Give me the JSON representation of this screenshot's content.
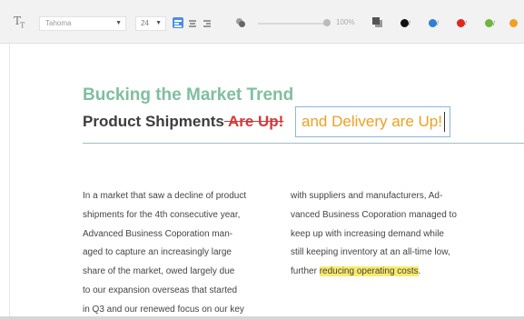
{
  "toolbar": {
    "text_tool_icon": "text-size-icon",
    "font": {
      "value": "Tahoma"
    },
    "size": {
      "value": "24"
    },
    "alignment": [
      "left",
      "center",
      "right"
    ],
    "active_alignment": "left",
    "zoom_label": "100%",
    "zoom_fraction": 0.95,
    "swatches": [
      {
        "name": "black",
        "color": "#111111"
      },
      {
        "name": "blue",
        "color": "#2f7fd9"
      },
      {
        "name": "red",
        "color": "#e0261d"
      },
      {
        "name": "green",
        "color": "#6ab83a"
      },
      {
        "name": "orange",
        "color": "#f0a020"
      }
    ]
  },
  "document": {
    "title": "Bucking the Market Trend",
    "subtitle": "Product Shipments",
    "struck": " Are Up!",
    "inserted": "and Delivery are Up!",
    "colors": {
      "title": "#7fbf9f",
      "strike": "#d23b3b",
      "inserted": "#f0a020",
      "highlight": "#f7ec6a"
    },
    "column1": [
      "In a market that saw a decline of product",
      "shipments for the 4th consecutive year,",
      "Advanced Business Coporation man-",
      "aged to capture an increasingly large",
      "share of the market, owed largely due",
      "to our expansion overseas that started",
      "in Q3 and our renewed focus on our key"
    ],
    "column2": [
      "with suppliers and manufacturers, Ad-",
      "vanced Business Coporation managed to",
      "keep up with increasing demand while",
      "still keeping inventory at an all-time low,"
    ],
    "column2_last": {
      "before": "further ",
      "highlight": "reducing operating costs",
      "after": "."
    }
  }
}
